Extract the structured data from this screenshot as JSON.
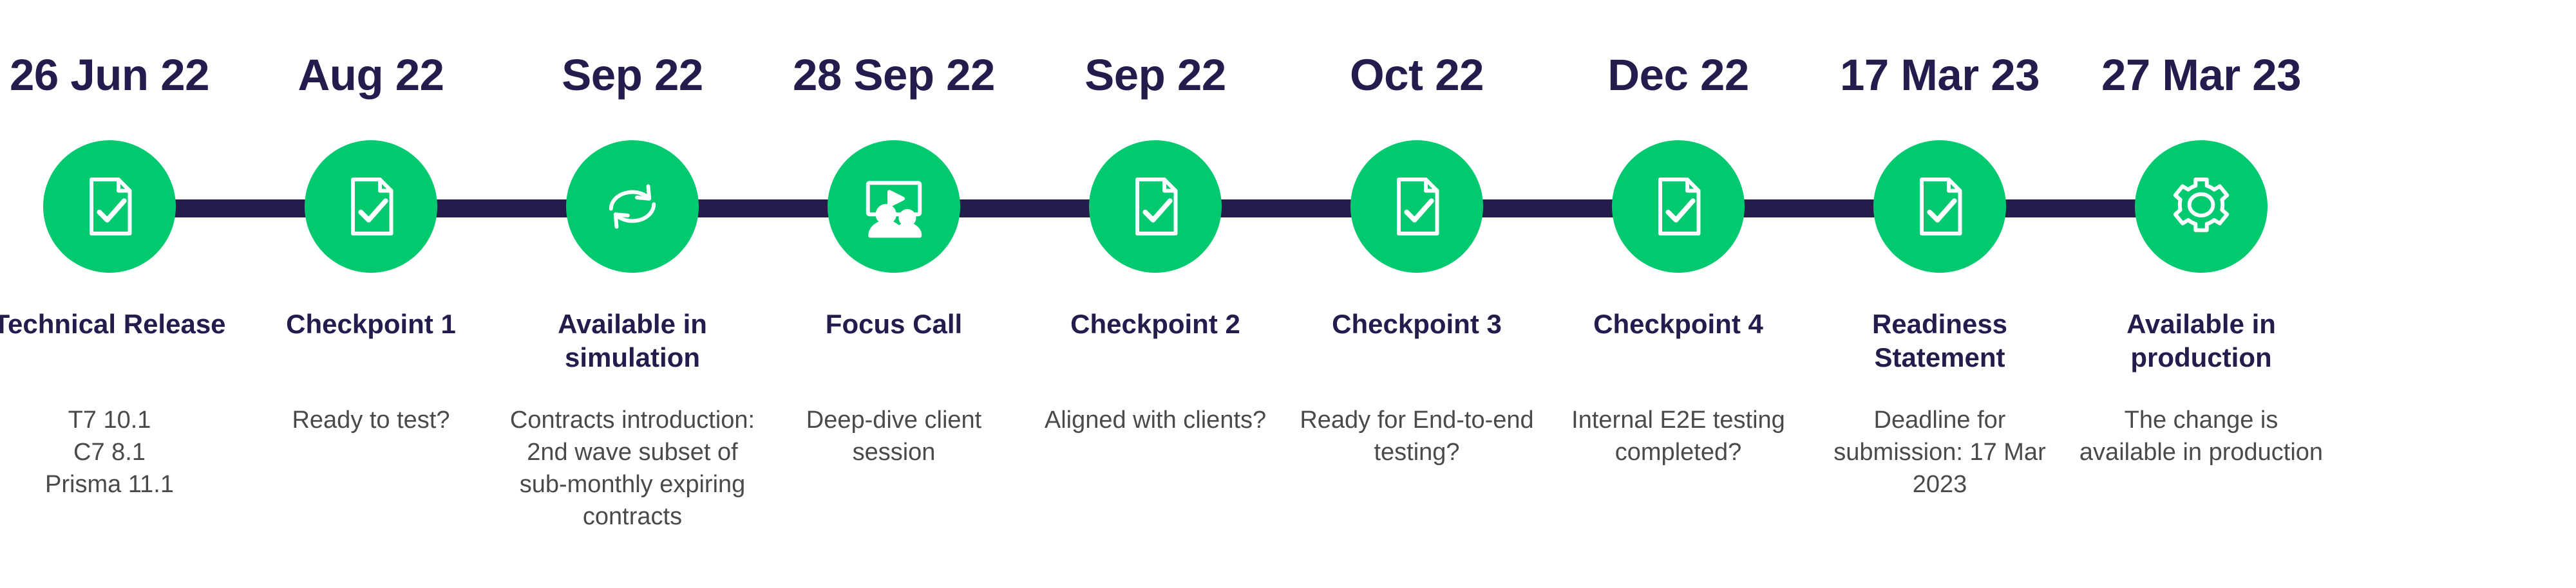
{
  "theme": {
    "accent_green": "#00C96F",
    "navy": "#251C4E",
    "body_gray": "#4A4A4A",
    "background": "#FFFFFF"
  },
  "timeline": {
    "connector_color": "#251C4E",
    "items": [
      {
        "date": "26 Jun 22",
        "title": "Technical Release",
        "description": "T7 10.1\nC7 8.1\nPrisma 11.1",
        "icon": "document-check-icon"
      },
      {
        "date": "Aug 22",
        "title": "Checkpoint 1",
        "description": "Ready to test?",
        "icon": "document-check-icon"
      },
      {
        "date": "Sep 22",
        "title": "Available in simulation",
        "description": "Contracts introduction: 2nd wave subset of sub-monthly expiring contracts",
        "icon": "refresh-sync-icon"
      },
      {
        "date": "28 Sep 22",
        "title": "Focus Call",
        "description": "Deep-dive client session",
        "icon": "presentation-people-icon"
      },
      {
        "date": "Sep 22",
        "title": "Checkpoint 2",
        "description": "Aligned with clients?",
        "icon": "document-check-icon"
      },
      {
        "date": "Oct 22",
        "title": "Checkpoint 3",
        "description": "Ready for End-to-end testing?",
        "icon": "document-check-icon"
      },
      {
        "date": "Dec 22",
        "title": "Checkpoint 4",
        "description": "Internal E2E testing completed?",
        "icon": "document-check-icon"
      },
      {
        "date": "17 Mar 23",
        "title": "Readiness Statement",
        "description": "Deadline for submission: 17 Mar 2023",
        "icon": "document-check-icon"
      },
      {
        "date": "27 Mar 23",
        "title": "Available in production",
        "description": "The change is available in production",
        "icon": "gear-icon"
      }
    ]
  }
}
